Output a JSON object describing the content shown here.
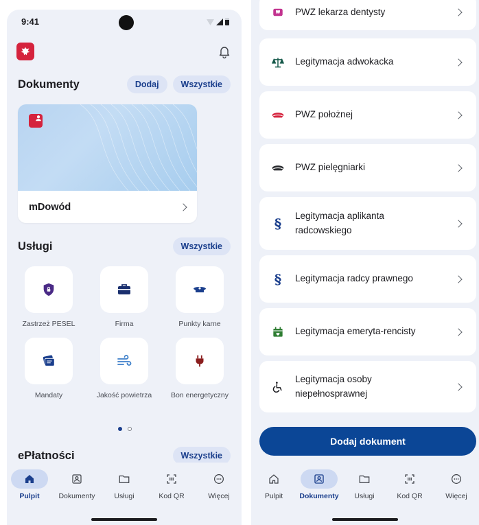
{
  "status": {
    "time": "9:41"
  },
  "left": {
    "documents": {
      "title": "Dokumenty",
      "add_label": "Dodaj",
      "all_label": "Wszystkie"
    },
    "card": {
      "name": "mDowód"
    },
    "services": {
      "title": "Usługi",
      "all_label": "Wszystkie",
      "tiles": [
        {
          "label": "Zastrzeż PESEL",
          "icon": "shield-lock-icon"
        },
        {
          "label": "Firma",
          "icon": "briefcase-icon"
        },
        {
          "label": "Punkty karne",
          "icon": "police-cap-icon"
        },
        {
          "label": "Mandaty",
          "icon": "tickets-icon"
        },
        {
          "label": "Jakość powietrza",
          "icon": "wind-icon"
        },
        {
          "label": "Bon energetyczny",
          "icon": "plug-icon"
        }
      ]
    },
    "payments": {
      "title": "ePłatności",
      "all_label": "Wszystkie"
    },
    "nav": [
      {
        "label": "Pulpit",
        "icon": "home-icon",
        "active": true
      },
      {
        "label": "Dokumenty",
        "icon": "id-card-icon"
      },
      {
        "label": "Usługi",
        "icon": "folder-icon"
      },
      {
        "label": "Kod QR",
        "icon": "qr-scan-icon"
      },
      {
        "label": "Więcej",
        "icon": "more-icon"
      }
    ]
  },
  "right": {
    "items": [
      {
        "label": "PWZ lekarza dentysty",
        "icon": "tooth-icon"
      },
      {
        "label": "Legitymacja adwokacka",
        "icon": "scales-icon"
      },
      {
        "label": "PWZ położnej",
        "icon": "midwife-cap-icon"
      },
      {
        "label": "PWZ pielęgniarki",
        "icon": "nurse-cap-icon"
      },
      {
        "label": "Legitymacja aplikanta radcowskiego",
        "icon": "paragraph-icon"
      },
      {
        "label": "Legitymacja radcy prawnego",
        "icon": "paragraph-icon"
      },
      {
        "label": "Legitymacja emeryta-rencisty",
        "icon": "calendar-heart-icon"
      },
      {
        "label": "Legitymacja osoby niepełnosprawnej",
        "icon": "wheelchair-icon"
      }
    ],
    "add_button": "Dodaj dokument",
    "nav": [
      {
        "label": "Pulpit",
        "icon": "home-icon"
      },
      {
        "label": "Dokumenty",
        "icon": "id-card-icon",
        "active": true
      },
      {
        "label": "Usługi",
        "icon": "folder-icon"
      },
      {
        "label": "Kod QR",
        "icon": "qr-scan-icon"
      },
      {
        "label": "Więcej",
        "icon": "more-icon"
      }
    ]
  },
  "colors": {
    "accent": "#1a3e8c",
    "primary_button": "#0b4696",
    "brand_red": "#d5233d",
    "background": "#eef1f8",
    "pill": "#dde4f5"
  }
}
